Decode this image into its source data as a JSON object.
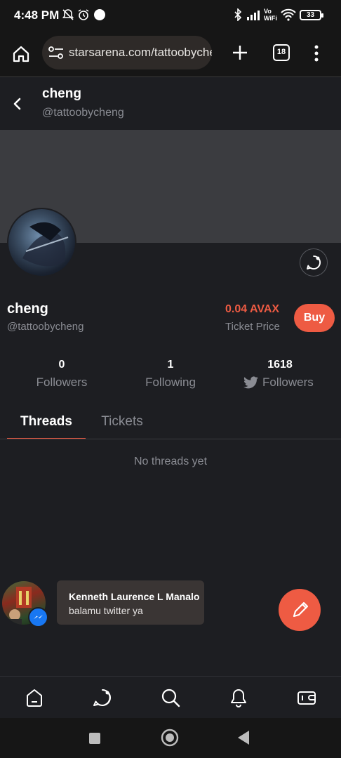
{
  "status_bar": {
    "time": "4:48 PM",
    "network_label_top": "Vo",
    "network_label_bottom": "WiFi",
    "battery": "33"
  },
  "browser": {
    "url": "starsarena.com/tattoobycheng",
    "tab_count": "18"
  },
  "header": {
    "name": "cheng",
    "handle": "@tattoobycheng"
  },
  "profile": {
    "name": "cheng",
    "handle": "@tattoobycheng",
    "ticket_price": "0.04 AVAX",
    "ticket_price_label": "Ticket Price",
    "buy_label": "Buy"
  },
  "stats": [
    {
      "value": "0",
      "label": "Followers"
    },
    {
      "value": "1",
      "label": "Following"
    },
    {
      "value": "1618",
      "label": "Followers"
    }
  ],
  "tabs": [
    {
      "label": "Threads",
      "active": true
    },
    {
      "label": "Tickets",
      "active": false
    }
  ],
  "empty_state": "No threads yet",
  "chat_notification": {
    "sender": "Kenneth Laurence L Manalo",
    "message": "balamu twitter ya"
  },
  "bottom_nav": [
    "home-icon",
    "chat-icon",
    "search-icon",
    "bell-icon",
    "wallet-icon"
  ],
  "colors": {
    "accent": "#ee5b43",
    "background": "#1d1e22",
    "muted_text": "#8a8c93",
    "banner": "#3b3c40"
  }
}
